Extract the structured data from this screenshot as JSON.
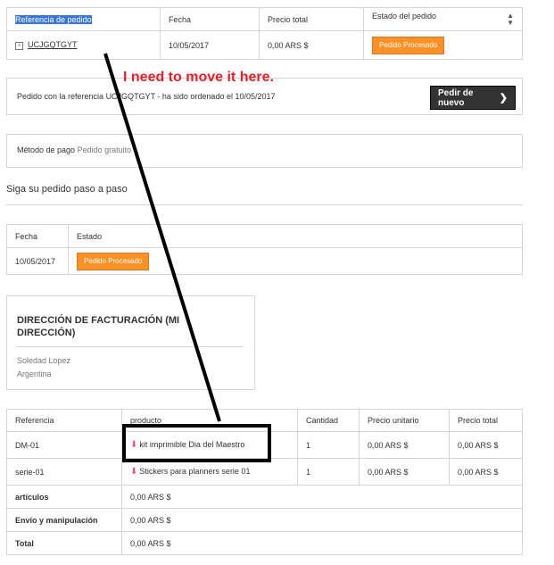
{
  "orders_table": {
    "headers": [
      "Referencia de pedido",
      "Fecha",
      "Precio total",
      "Estado del pedido"
    ],
    "row": {
      "reference": "UCJGQTGYT",
      "date": "10/05/2017",
      "total": "0,00 ARS $",
      "status": "Pedido Procesado"
    }
  },
  "annotation": "I need to move it here.",
  "reorder": {
    "message": "Pedido con la referencia UCJGQTGYT - ha sido ordenado el 10/05/2017",
    "button_label": "Pedir de nuevo"
  },
  "payment": {
    "label": "Método de pago",
    "value": "Pedido gratuito"
  },
  "follow_title": "Siga su pedido paso a paso",
  "status_history": {
    "headers": [
      "Fecha",
      "Estado"
    ],
    "rows": [
      {
        "date": "10/05/2017",
        "status": "Pedido Procesado"
      }
    ]
  },
  "billing_address": {
    "title": "DIRECCIÓN DE FACTURACIÓN (MI DIRECCIÓN)",
    "name": "Soledad Lopez",
    "country": "Argentina"
  },
  "products_table": {
    "headers": [
      "Referencia",
      "producto",
      "Cantidad",
      "Precio unitario",
      "Precio total"
    ],
    "rows": [
      {
        "ref": "DM-01",
        "product": "kit imprimible Dia del Maestro",
        "qty": "1",
        "unit": "0,00 ARS $",
        "total": "0,00 ARS $"
      },
      {
        "ref": "serie-01",
        "product": "Stickers para planners serie 01",
        "qty": "1",
        "unit": "0,00 ARS $",
        "total": "0,00 ARS $"
      }
    ],
    "summary": [
      {
        "label": "artículos",
        "value": "0,00 ARS $"
      },
      {
        "label": "Envío y manipulación",
        "value": "0,00 ARS $"
      },
      {
        "label": "Total",
        "value": "0,00 ARS $"
      }
    ]
  },
  "colors": {
    "status_badge": "#fe9126",
    "annotation_text": "#e81f28",
    "button_dark": "#333333",
    "selection": "#3875d7",
    "product_icon": "#e94e8c"
  },
  "icons": {
    "expand": "plus-square-icon",
    "sort": "sort-arrows-icon",
    "chevron": "chevron-right-icon",
    "product": "download-arrow-icon"
  }
}
